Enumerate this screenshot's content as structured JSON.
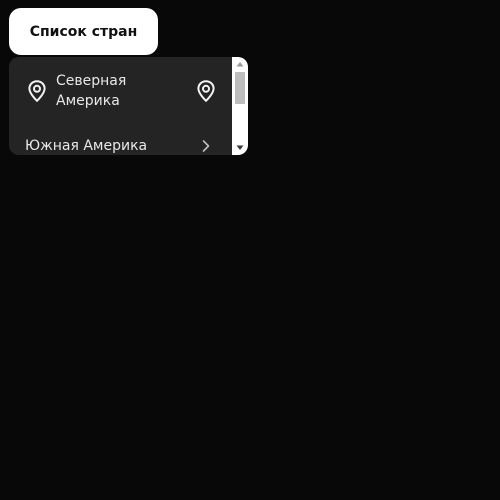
{
  "header": {
    "title": "Список стран"
  },
  "list": {
    "items": [
      {
        "label": "Северная Америка",
        "leading_icon": "location-pin-icon",
        "trailing_icon": "location-pin-icon"
      },
      {
        "label": "Южная Америка",
        "trailing_icon": "chevron-right-icon"
      }
    ]
  },
  "colors": {
    "background": "#080808",
    "panel": "#242424",
    "title_button": "#ffffff",
    "text_light": "#e8e8e8",
    "text_dark": "#111111"
  }
}
